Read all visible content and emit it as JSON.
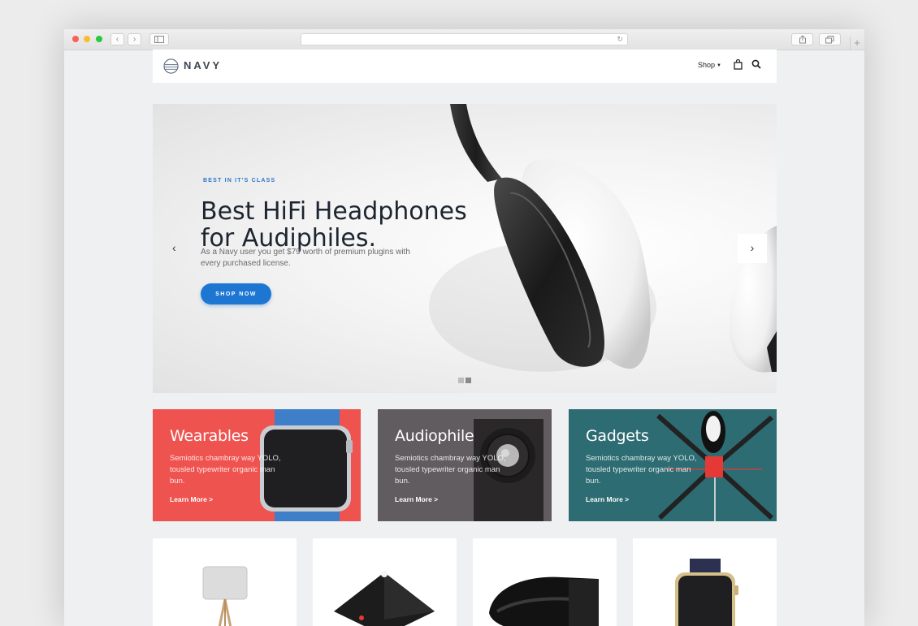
{
  "browser": {
    "back_icon": "chevron-left-icon",
    "forward_icon": "chevron-right-icon",
    "sidebar_icon": "sidebar-icon",
    "reload_icon": "reload-icon",
    "share_icon": "share-icon",
    "tabs_icon": "tabs-icon",
    "new_tab_icon": "plus-icon"
  },
  "navbar": {
    "logo_text": "NAVY",
    "shop_label": "Shop",
    "bag_icon": "shopping-bag-icon",
    "search_icon": "search-icon"
  },
  "hero": {
    "kicker": "BEST IN IT'S CLASS",
    "title": "Best HiFi Headphones for Audiphiles.",
    "description": "As a Navy user you get $79 worth of premium plugins with every purchased license.",
    "cta_label": "SHOP NOW",
    "slide_count": 2,
    "active_slide": 2
  },
  "promos": [
    {
      "title": "Wearables",
      "text": "Semiotics chambray way YOLO, tousled typewriter organic man bun.",
      "link": "Learn More >",
      "color": "#ef5350"
    },
    {
      "title": "Audiophile",
      "text": "Semiotics chambray way YOLO, tousled typewriter organic man bun.",
      "link": "Learn More >",
      "color": "#615c60"
    },
    {
      "title": "Gadgets",
      "text": "Semiotics chambray way YOLO, tousled typewriter organic man bun.",
      "link": "Learn More >",
      "color": "#2d6c73"
    }
  ],
  "products": [
    {
      "image": "floor-lamp"
    },
    {
      "image": "black-drone"
    },
    {
      "image": "vr-headset"
    },
    {
      "image": "smart-watch"
    }
  ],
  "colors": {
    "accent": "#1c76d2",
    "title_text": "#1d2530",
    "page_background": "#eef0f2"
  }
}
